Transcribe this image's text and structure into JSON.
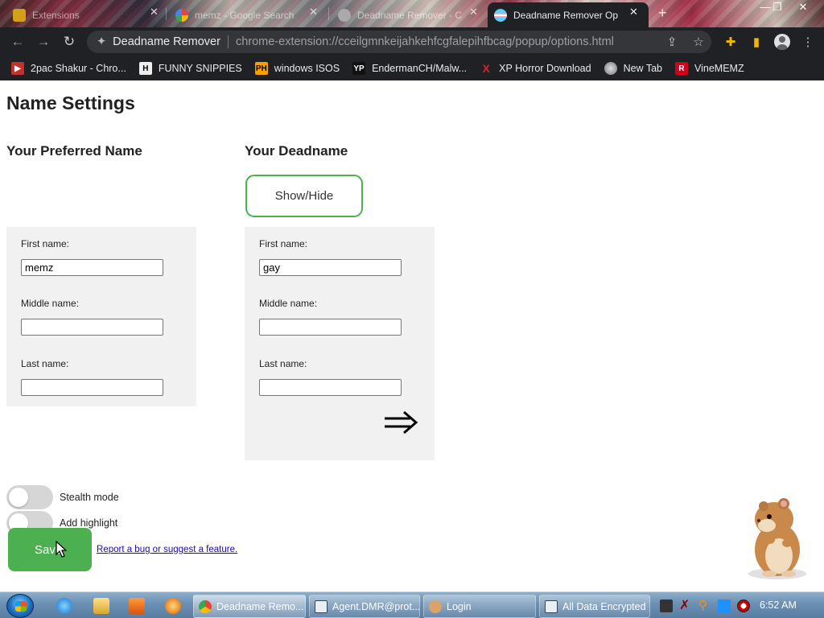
{
  "browser": {
    "tabs": [
      {
        "title": "Extensions",
        "active": false
      },
      {
        "title": "memz - Google Search",
        "active": false
      },
      {
        "title": "Deadname Remover - C",
        "active": false
      },
      {
        "title": "Deadname Remover Op",
        "active": true
      }
    ],
    "omnibox": {
      "site": "Deadname Remover",
      "url": "chrome-extension://cceilgmnkeijahkehfcgfalepihfbcag/popup/options.html"
    },
    "bookmarks": [
      {
        "label": "2pac Shakur - Chro...",
        "icon": "video-icon",
        "color": "#c4302b"
      },
      {
        "label": "FUNNY SNIPPIES",
        "icon": "letter-h-icon",
        "color": "#333333"
      },
      {
        "label": "windows ISOS",
        "icon": "ph-logo-icon",
        "color": "#f7a100"
      },
      {
        "label": "EndermanCH/Malw...",
        "icon": "yp-logo-icon",
        "color": "#222222"
      },
      {
        "label": "XP Horror Download",
        "icon": "x-logo-icon",
        "color": "#d11f2a"
      },
      {
        "label": "New Tab",
        "icon": "globe-icon",
        "color": "#888888"
      },
      {
        "label": "VineMEMZ",
        "icon": "r-logo-icon",
        "color": "#d0021b"
      }
    ]
  },
  "page": {
    "title": "Name Settings",
    "preferred": {
      "heading": "Your Preferred Name",
      "first_label": "First name:",
      "first_value": "memz",
      "middle_label": "Middle name:",
      "middle_value": "",
      "last_label": "Last name:",
      "last_value": ""
    },
    "deadname": {
      "heading": "Your Deadname",
      "show_hide_label": "Show/Hide",
      "first_label": "First name:",
      "first_value": "gay",
      "middle_label": "Middle name:",
      "middle_value": "",
      "last_label": "Last name:",
      "last_value": "",
      "arrow_icon": "double-arrow-right-icon"
    },
    "toggles": [
      {
        "label": "Stealth mode",
        "on": false
      },
      {
        "label": "Add highlight",
        "on": false
      }
    ],
    "save_label": "Save",
    "report_link": "Report a bug or suggest a feature.",
    "accent_color": "#4caf50"
  },
  "taskbar": {
    "buttons": [
      {
        "label": "Deadname Remo...",
        "icon": "chrome-icon",
        "active": true
      },
      {
        "label": "Agent.DMR@prot...",
        "icon": "window-icon",
        "active": false
      },
      {
        "label": "Login",
        "icon": "user-icon",
        "active": false
      },
      {
        "label": "All Data Encrypted",
        "icon": "window-icon",
        "active": false
      }
    ],
    "clock": "6:52 AM"
  }
}
